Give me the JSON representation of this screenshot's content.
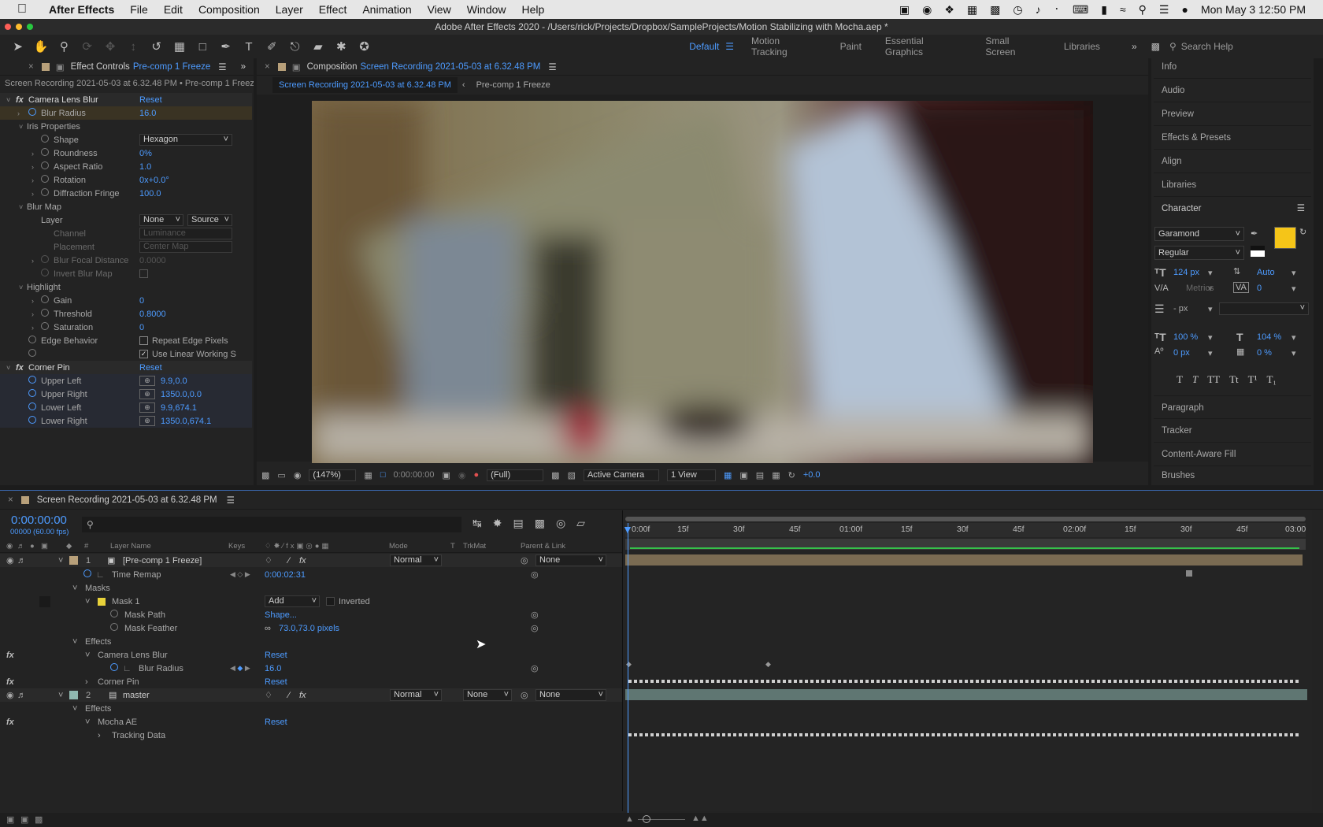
{
  "menubar": {
    "app_name": "After Effects",
    "items": [
      "File",
      "Edit",
      "Composition",
      "Layer",
      "Effect",
      "Animation",
      "View",
      "Window",
      "Help"
    ],
    "datetime": "Mon May 3  12:50 PM"
  },
  "titlebar": {
    "title": "Adobe After Effects 2020 - /Users/rick/Projects/Dropbox/SampleProjects/Motion Stabilizing with Mocha.aep *"
  },
  "workspaces": {
    "items": [
      "Default",
      "Motion Tracking",
      "Paint",
      "Essential Graphics",
      "Small Screen",
      "Libraries"
    ],
    "active": "Default",
    "search_placeholder": "Search Help"
  },
  "effect_controls": {
    "tab_prefix": "Effect Controls",
    "tab_layer": "Pre-comp 1 Freeze",
    "subtitle": "Screen Recording 2021-05-03 at 6.32.48 PM • Pre-comp 1 Freeze",
    "rows": [
      {
        "label": "Camera Lens Blur",
        "value": "Reset"
      },
      {
        "label": "Blur Radius",
        "value": "16.0"
      },
      {
        "label": "Iris Properties",
        "value": ""
      },
      {
        "label": "Shape",
        "value": "Hexagon"
      },
      {
        "label": "Roundness",
        "value": "0%"
      },
      {
        "label": "Aspect Ratio",
        "value": "1.0"
      },
      {
        "label": "Rotation",
        "value": "0x+0.0°"
      },
      {
        "label": "Diffraction Fringe",
        "value": "100.0"
      },
      {
        "label": "Blur Map",
        "value": ""
      },
      {
        "label": "Layer",
        "value": "None"
      },
      {
        "label": "Channel",
        "value": "Luminance"
      },
      {
        "label": "Placement",
        "value": "Center Map"
      },
      {
        "label": "Blur Focal Distance",
        "value": "0.0000"
      },
      {
        "label": "Invert Blur Map",
        "value": ""
      },
      {
        "label": "Highlight",
        "value": ""
      },
      {
        "label": "Gain",
        "value": "0"
      },
      {
        "label": "Threshold",
        "value": "0.8000"
      },
      {
        "label": "Saturation",
        "value": "0"
      },
      {
        "label": "Edge Behavior",
        "value": "Repeat Edge Pixels"
      },
      {
        "label": "",
        "value": "Use Linear Working S"
      },
      {
        "label": "Corner Pin",
        "value": "Reset"
      },
      {
        "label": "Upper Left",
        "value": "9.9,0.0"
      },
      {
        "label": "Upper Right",
        "value": "1350.0,0.0"
      },
      {
        "label": "Lower Left",
        "value": "9.9,674.1"
      },
      {
        "label": "Lower Right",
        "value": "1350.0,674.1"
      }
    ],
    "layer_source": "Source"
  },
  "composition": {
    "tab_prefix": "Composition",
    "tab_name": "Screen Recording 2021-05-03 at 6.32.48 PM",
    "crumb1": "Screen Recording 2021-05-03 at 6.32.48 PM",
    "crumb2": "Pre-comp 1 Freeze",
    "footer": {
      "zoom": "(147%)",
      "timecode": "0:00:00:00",
      "resolution": "(Full)",
      "camera": "Active Camera",
      "view": "1 View",
      "exposure": "+0.0"
    }
  },
  "right_panels": {
    "items": [
      "Info",
      "Audio",
      "Preview",
      "Effects & Presets",
      "Align",
      "Libraries",
      "Character",
      "Paragraph",
      "Tracker",
      "Content-Aware Fill",
      "Brushes"
    ],
    "character": {
      "font": "Garamond",
      "style": "Regular",
      "size": "124 px",
      "leading": "Auto",
      "kerning": "Metrics",
      "tracking": "0",
      "line": "- px",
      "vscale": "100 %",
      "hscale": "104 %",
      "baseline": "0 px",
      "tsume": "0 %",
      "fill_color": "#f5c518",
      "styles": [
        "T",
        "T",
        "TT",
        "Tt",
        "T¹",
        "T₁"
      ]
    }
  },
  "timeline": {
    "tab": "Screen Recording 2021-05-03 at 6.32.48 PM",
    "timecode": "0:00:00:00",
    "frames": "00000 (60.00 fps)",
    "headers": {
      "num": "#",
      "layer": "Layer Name",
      "keys": "Keys",
      "mode": "Mode",
      "t": "T",
      "trkmat": "TrkMat",
      "parent": "Parent & Link"
    },
    "ruler": [
      "0:00f",
      "15f",
      "30f",
      "45f",
      "01:00f",
      "15f",
      "30f",
      "45f",
      "02:00f",
      "15f",
      "30f",
      "45f",
      "03:00"
    ],
    "rows": [
      {
        "name": "[Pre-comp 1 Freeze]",
        "num": "1",
        "mode": "Normal",
        "parent": "None"
      },
      {
        "name": "Time Remap",
        "value": "0:00:02:31"
      },
      {
        "name": "Masks"
      },
      {
        "name": "Mask 1",
        "mode": "Add",
        "extra": "Inverted"
      },
      {
        "name": "Mask Path",
        "value": "Shape..."
      },
      {
        "name": "Mask Feather",
        "value": "73.0,73.0 pixels"
      },
      {
        "name": "Effects"
      },
      {
        "name": "Camera Lens Blur",
        "value": "Reset"
      },
      {
        "name": "Blur Radius",
        "value": "16.0"
      },
      {
        "name": "Corner Pin",
        "value": "Reset"
      },
      {
        "name": "master",
        "num": "2",
        "mode": "Normal",
        "trkmat": "None",
        "parent": "None"
      },
      {
        "name": "Effects"
      },
      {
        "name": "Mocha AE",
        "value": "Reset"
      },
      {
        "name": "Tracking Data"
      }
    ]
  },
  "colors": {
    "accent": "#4d9bff",
    "layer1_bar": "#7a6b52",
    "layer2_bar": "#5f7672",
    "label_tan": "#b8a07a",
    "label_teal": "#8fb8b0",
    "mask_yellow": "#e8d23a"
  }
}
